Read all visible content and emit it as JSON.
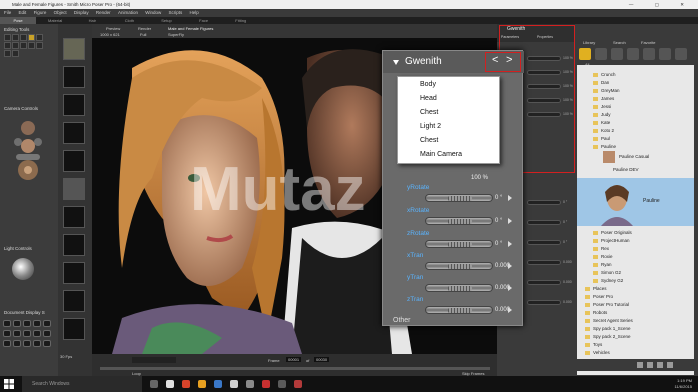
{
  "window": {
    "title": "Male and Female Figures - Smith Micro Poser Pro - (64-bit)",
    "controls": [
      "—",
      "▢",
      "✕"
    ]
  },
  "menu": [
    "File",
    "Edit",
    "Figure",
    "Object",
    "Display",
    "Render",
    "Animation",
    "Window",
    "Scripts",
    "Help"
  ],
  "room_tabs": [
    "Pose",
    "Material",
    "Hair",
    "Cloth",
    "Setup",
    "Face",
    "Fitting"
  ],
  "left_panel": {
    "editing_tools": "Editing Tools",
    "camera_controls": "Camera Controls",
    "light_controls": "Light Controls",
    "document_display": "Document Display S"
  },
  "viewport": {
    "tabs": [
      "Preview",
      "Render"
    ],
    "doc_title": "Male and Female Figures",
    "resolution": "1000 x 621",
    "figure": "Full",
    "shader": "SuperFly",
    "frame_label": "Frame",
    "frame_value": "00001",
    "frame_of": "of",
    "frame_total": "00030",
    "loop_label": "Loop",
    "skip_frames_label": "Skip Frames",
    "fps_label": "30 Fps"
  },
  "param_strip": {
    "title": "Gwenith",
    "tabs": [
      "Parameters",
      "Properties"
    ],
    "values": [
      "100 %",
      "100 %",
      "100 %",
      "100 %",
      "100 %",
      "0 °",
      "0 °",
      "0 °",
      "0.000",
      "0.000",
      "0.000"
    ]
  },
  "gwenith_panel": {
    "title": "Gwenith",
    "nav_prev": "<",
    "nav_next": ">",
    "dropdown": [
      "Body",
      "Head",
      "Chest",
      "Light 2",
      "Chest",
      "Main Camera"
    ],
    "params": [
      {
        "label": "yRotate",
        "value": "0 °"
      },
      {
        "label": "xRotate",
        "value": "0 °"
      },
      {
        "label": "zRotate",
        "value": "0 °"
      },
      {
        "label": "xTran",
        "value": "0.000"
      },
      {
        "label": "yTran",
        "value": "0.000"
      },
      {
        "label": "zTran",
        "value": "0.000"
      }
    ],
    "first_value": "100 %",
    "other": "Other"
  },
  "library": {
    "tabs": [
      "Library",
      "Search",
      "Favorite"
    ],
    "section": "All",
    "items": [
      {
        "label": "Crunch",
        "level": 1
      },
      {
        "label": "Dan",
        "level": 1
      },
      {
        "label": "GreyMan",
        "level": 1
      },
      {
        "label": "James",
        "level": 1
      },
      {
        "label": "Jessi",
        "level": 1
      },
      {
        "label": "Judy",
        "level": 1
      },
      {
        "label": "Kate",
        "level": 1
      },
      {
        "label": "Koto 2",
        "level": 1
      },
      {
        "label": "Paul",
        "level": 1
      },
      {
        "label": "Pauline",
        "level": 1
      },
      {
        "label": "Pauline Casual",
        "level": 2
      },
      {
        "label": "Pauline DEV",
        "level": 2
      }
    ],
    "preview_label": "Pauline",
    "items2": [
      {
        "label": "Poser Originals",
        "level": 1
      },
      {
        "label": "ProjectHuman",
        "level": 1
      },
      {
        "label": "Rex",
        "level": 1
      },
      {
        "label": "Roxie",
        "level": 1
      },
      {
        "label": "Ryan",
        "level": 1
      },
      {
        "label": "Simon G2",
        "level": 1
      },
      {
        "label": "Sydney G2",
        "level": 1
      },
      {
        "label": "Places",
        "level": 0
      },
      {
        "label": "Poser Pro",
        "level": 0
      },
      {
        "label": "Poser Pro Tutorial",
        "level": 0
      },
      {
        "label": "Robots",
        "level": 0
      },
      {
        "label": "Secret Agent Series",
        "level": 0
      },
      {
        "label": "Spy pack 1_Scene",
        "level": 0
      },
      {
        "label": "Spy pack 2_Scene",
        "level": 0
      },
      {
        "label": "Toys",
        "level": 0
      },
      {
        "label": "Vehicles",
        "level": 0
      }
    ]
  },
  "taskbar": {
    "search_placeholder": "Search Windows",
    "time": "1:19 PM",
    "date": "11/6/2015"
  },
  "watermark": "Mutaz",
  "colors": {
    "highlight_red": "#d32020",
    "param_label_blue": "#5ab4ff",
    "folder_yellow": "#e8c45a"
  }
}
